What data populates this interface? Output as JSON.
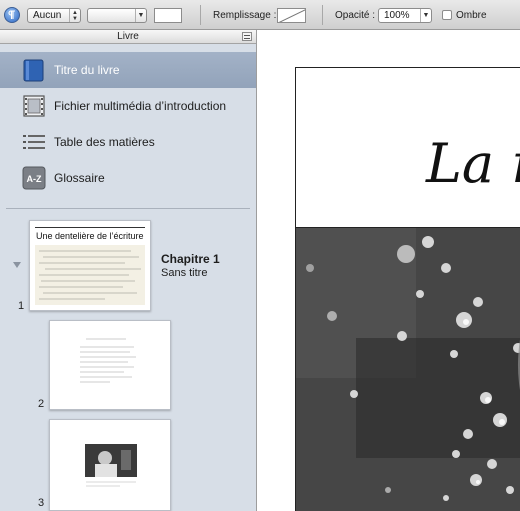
{
  "toolbar": {
    "border_style_value": "Aucun",
    "fill_label": "Remplissage :",
    "opacity_label": "Opacité :",
    "opacity_value": "100%",
    "shadow_label": "Ombre",
    "shadow_checked": false
  },
  "sidebar": {
    "header_title": "Livre",
    "nav_items": [
      {
        "label": "Titre du livre",
        "icon": "book-icon",
        "selected": true
      },
      {
        "label": "Fichier multimédia d’introduction",
        "icon": "film-icon",
        "selected": false
      },
      {
        "label": "Table des matières",
        "icon": "list-icon",
        "selected": false
      },
      {
        "label": "Glossaire",
        "icon": "glossary-icon",
        "selected": false,
        "icon_text": "A-Z"
      }
    ],
    "chapter": {
      "title": "Chapitre 1",
      "subtitle": "Sans titre",
      "pages": [
        {
          "number": "1",
          "heading": "Une dentelière de l’écriture"
        },
        {
          "number": "2"
        },
        {
          "number": "3"
        }
      ]
    }
  },
  "canvas": {
    "page_title": "La r"
  },
  "colors": {
    "sidebar_bg": "#d7dee7",
    "selected_bg": "#9aaac0",
    "accent": "#2a66c4"
  }
}
